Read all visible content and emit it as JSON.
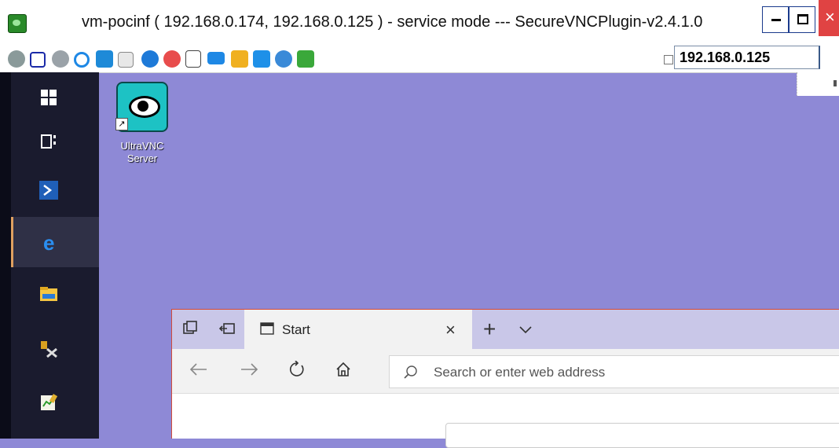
{
  "window": {
    "title": "vm-pocinf ( 192.168.0.174, 192.168.0.125 ) - service mode --- SecureVNCPlugin-v2.4.1.0"
  },
  "toolbar": {
    "host_value": "192.168.0.125",
    "icons": [
      "settings-cog-icon",
      "fullscreen-icon",
      "options-gear-icon",
      "refresh-icon",
      "windows-keys-icon",
      "ctrl-alt-del-icon",
      "info-icon",
      "disconnect-icon",
      "file-transfer-icon",
      "screen-icon",
      "chat-icon",
      "screenshot-icon",
      "select-window-icon",
      "text-chat-icon"
    ]
  },
  "desktop": {
    "icon_label": "UltraVNC Server"
  },
  "browser": {
    "tab_title": "Start",
    "address_placeholder": "Search or enter web address"
  },
  "colors": {
    "desktop_bg": "#8e89d6",
    "taskbar_bg": "#1a1b2e",
    "close_red": "#e04343"
  }
}
